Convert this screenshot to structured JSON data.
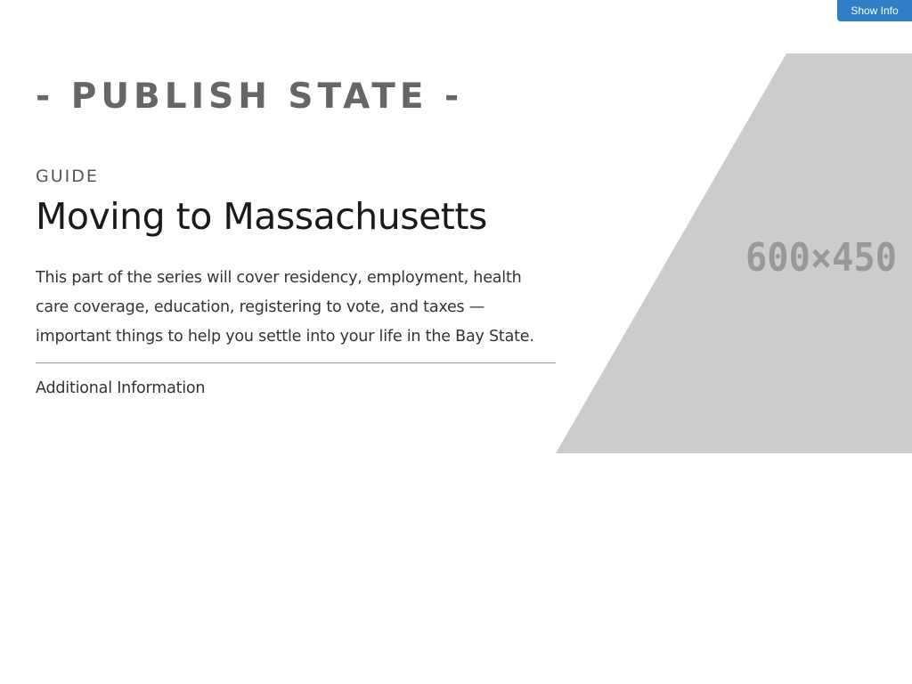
{
  "toolbar": {
    "show_info_label": "Show Info"
  },
  "banner": {
    "publish_state": "- PUBLISH STATE -"
  },
  "article": {
    "kicker": "GUIDE",
    "title": "Moving to Massachusetts",
    "description": "This part of the series will cover residency, employment, health care coverage, education, registering to vote, and taxes — important things to help you settle into your life in the Bay State.",
    "additional_info_label": "Additional Information"
  },
  "hero": {
    "placeholder_text": "600×450",
    "fill_color": "#cccccc",
    "text_color": "#999999"
  },
  "colors": {
    "accent": "#2e7fc6"
  }
}
